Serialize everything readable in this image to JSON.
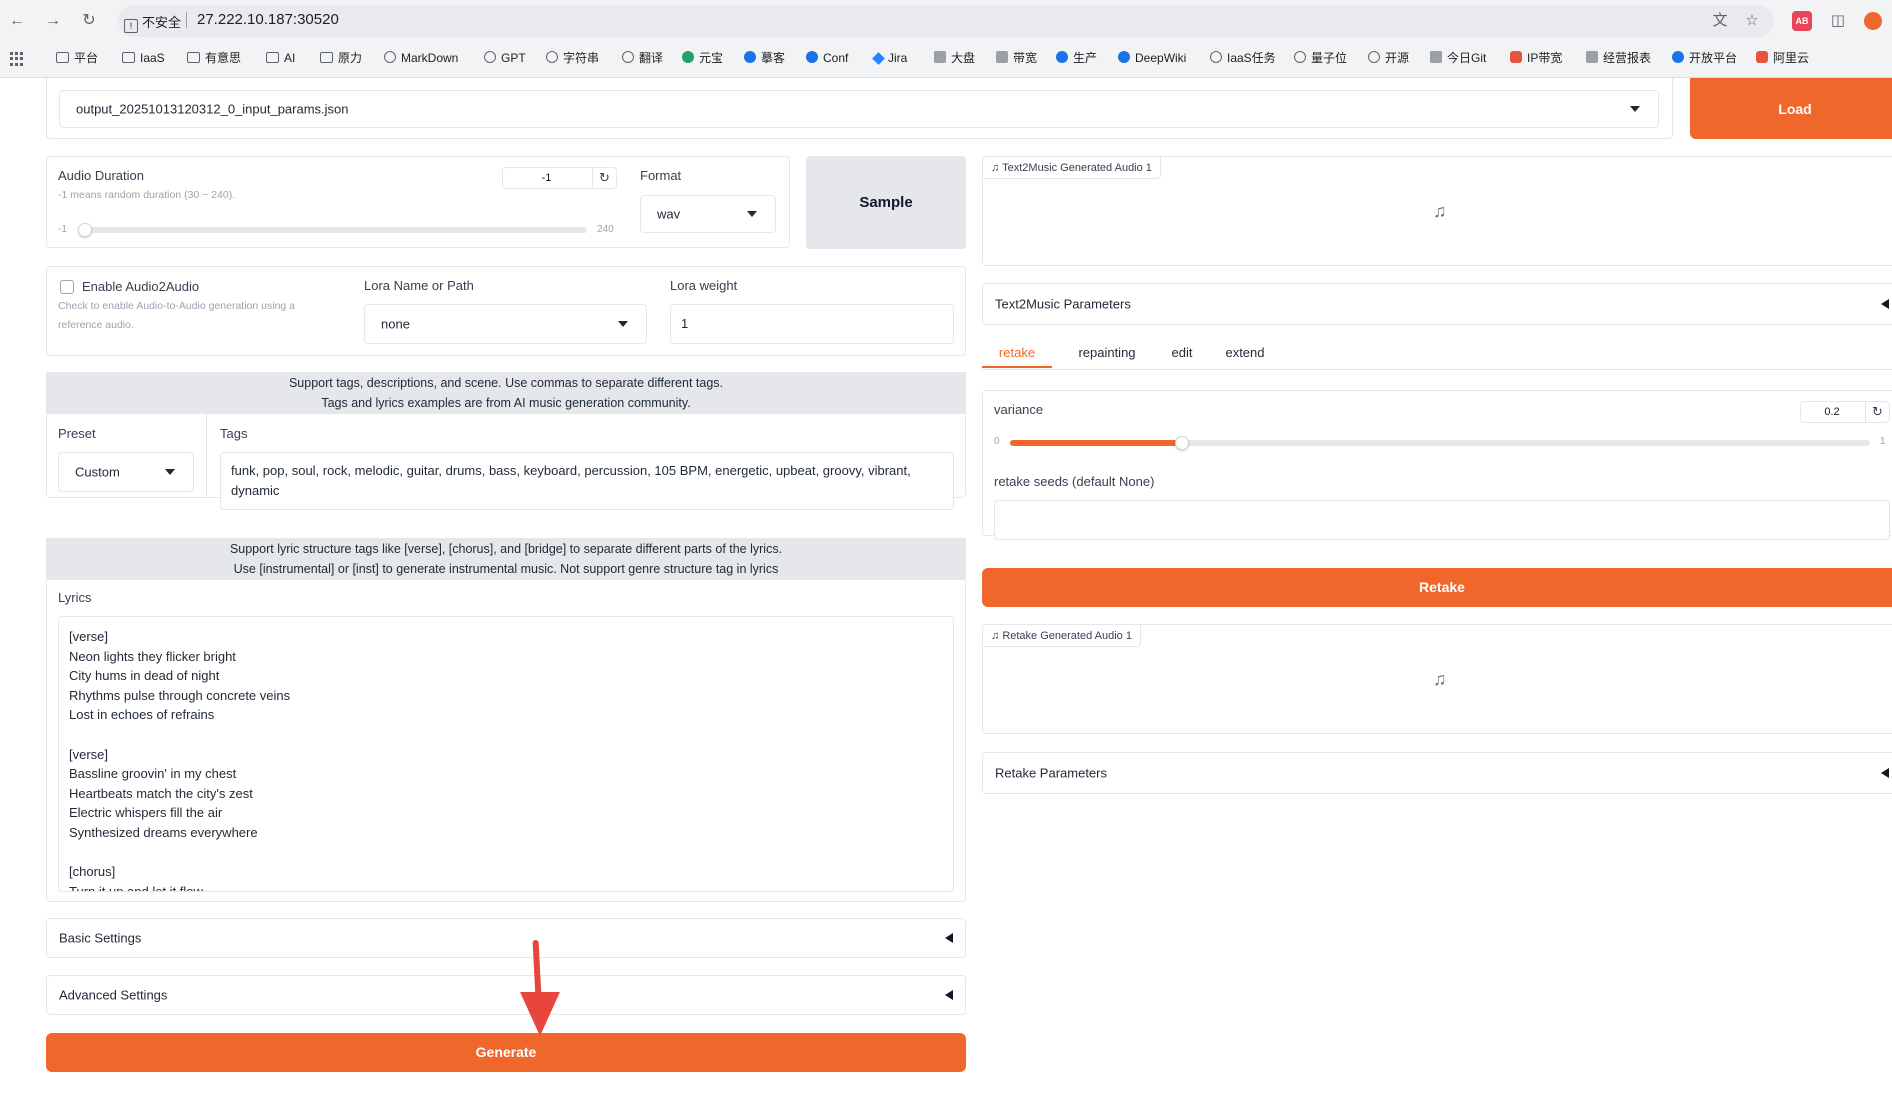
{
  "browser": {
    "security_label": "不安全",
    "url": "27.222.10.187:30520",
    "extension_badge": "AB",
    "bookmarks": [
      {
        "label": "平台",
        "icon": "folder-icon"
      },
      {
        "label": "IaaS",
        "icon": "folder-icon"
      },
      {
        "label": "有意思",
        "icon": "folder-icon"
      },
      {
        "label": "AI",
        "icon": "folder-icon"
      },
      {
        "label": "原力",
        "icon": "folder-icon"
      },
      {
        "label": "MarkDown",
        "icon": "markdown-icon"
      },
      {
        "label": "GPT",
        "icon": "gpt-icon"
      },
      {
        "label": "字符串",
        "icon": "gpt-icon"
      },
      {
        "label": "翻译",
        "icon": "gpt-icon"
      },
      {
        "label": "元宝",
        "icon": "yuanbao-icon"
      },
      {
        "label": "摹客",
        "icon": "mockplus-icon"
      },
      {
        "label": "Conf",
        "icon": "confluence-icon"
      },
      {
        "label": "Jira",
        "icon": "jira-icon"
      },
      {
        "label": "大盘",
        "icon": "grafana-icon"
      },
      {
        "label": "带宽",
        "icon": "grafana-icon"
      },
      {
        "label": "生产",
        "icon": "circle-blue-icon"
      },
      {
        "label": "DeepWiki",
        "icon": "deepwiki-icon"
      },
      {
        "label": "IaaS任务",
        "icon": "task-icon"
      },
      {
        "label": "量子位",
        "icon": "circle-icon"
      },
      {
        "label": "开源",
        "icon": "github-icon"
      },
      {
        "label": "今日Git",
        "icon": "doc-icon"
      },
      {
        "label": "IP带宽",
        "icon": "gear-icon"
      },
      {
        "label": "经营报表",
        "icon": "grafana-icon"
      },
      {
        "label": "开放平台",
        "icon": "x-icon"
      },
      {
        "label": "阿里云",
        "icon": "aliyun-icon"
      }
    ]
  },
  "load": {
    "file_value": "output_20251013120312_0_input_params.json",
    "button_label": "Load"
  },
  "duration": {
    "label": "Audio Duration",
    "hint": "-1 means random duration (30 ~ 240).",
    "value": "-1",
    "min": "-1",
    "max": "240",
    "fraction": 0.0
  },
  "format": {
    "label": "Format",
    "value": "wav"
  },
  "sample_button": "Sample",
  "audio2audio": {
    "label": "Enable Audio2Audio",
    "hint": "Check to enable Audio-to-Audio generation using a reference audio.",
    "checked": false
  },
  "lora": {
    "name_label": "Lora Name or Path",
    "name_value": "none",
    "weight_label": "Lora weight",
    "weight_value": "1"
  },
  "tags_banner": {
    "line1": "Support tags, descriptions, and scene. Use commas to separate different tags.",
    "line2": "Tags and lyrics examples are from AI music generation community."
  },
  "preset": {
    "label": "Preset",
    "value": "Custom"
  },
  "tags": {
    "label": "Tags",
    "value": "funk, pop, soul, rock, melodic, guitar, drums, bass, keyboard, percussion, 105 BPM, energetic, upbeat, groovy, vibrant, dynamic"
  },
  "lyrics_banner": {
    "line1": "Support lyric structure tags like [verse], [chorus], and [bridge] to separate different parts of the lyrics.",
    "line2": "Use [instrumental] or [inst] to generate instrumental music. Not support genre structure tag in lyrics"
  },
  "lyrics": {
    "label": "Lyrics",
    "value": "[verse]\nNeon lights they flicker bright\nCity hums in dead of night\nRhythms pulse through concrete veins\nLost in echoes of refrains\n\n[verse]\nBassline groovin' in my chest\nHeartbeats match the city's zest\nElectric whispers fill the air\nSynthesized dreams everywhere\n\n[chorus]\nTurn it up and let it flow"
  },
  "basic_settings": "Basic Settings",
  "advanced_settings": "Advanced Settings",
  "generate_button": "Generate",
  "text2music_audio": {
    "label": "Text2Music Generated Audio 1"
  },
  "text2music_params": "Text2Music Parameters",
  "tabs": [
    {
      "label": "retake",
      "active": true
    },
    {
      "label": "repainting",
      "active": false
    },
    {
      "label": "edit",
      "active": false
    },
    {
      "label": "extend",
      "active": false
    }
  ],
  "variance": {
    "label": "variance",
    "value": "0.2",
    "min": "0",
    "max": "1",
    "fraction": 0.2
  },
  "retake_seeds": {
    "label": "retake seeds (default None)",
    "value": ""
  },
  "retake_button": "Retake",
  "retake_audio": {
    "label": "Retake Generated Audio 1"
  },
  "retake_params": "Retake Parameters",
  "colors": {
    "accent": "#f0672c",
    "annotation_arrow": "#e8453c"
  }
}
